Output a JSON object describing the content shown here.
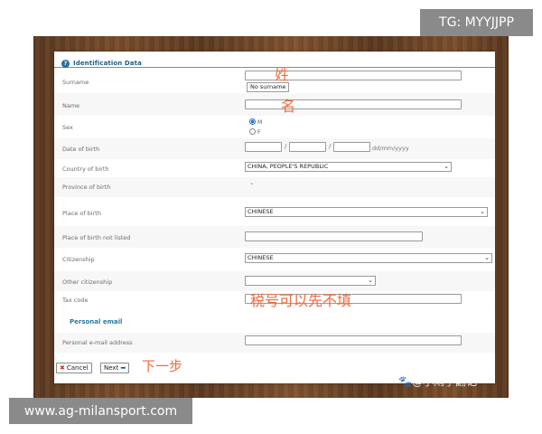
{
  "overlays": {
    "tg_badge": "TG: MYYJJPP",
    "url_badge": "www.ag-milansport.com",
    "watermark": "🐾@小雨学翻记"
  },
  "form": {
    "section_title": "Identification Data",
    "fields": {
      "surname_label": "Surname",
      "no_surname_button": "No surname",
      "name_label": "Name",
      "sex_label": "Sex",
      "sex_options": [
        "M",
        "F"
      ],
      "sex_selected": "M",
      "dob_label": "Date of birth",
      "dob_format_hint": "dd/mm/yyyy",
      "country_of_birth_label": "Country of birth",
      "country_of_birth_value": "CHINA, PEOPLE'S REPUBLIC",
      "province_of_birth_label": "Province of birth",
      "place_of_birth_label": "Place of birth",
      "place_of_birth_value": "CHINESE",
      "place_not_listed_label": "Place of birth not listed",
      "citizenship_label": "Citizenship",
      "citizenship_value": "CHINESE",
      "other_citizenship_label": "Other citizenship",
      "tax_code_label": "Tax code"
    },
    "personal_email_heading": "Personal email",
    "personal_email_label": "Personal e-mail address",
    "buttons": {
      "cancel": "Cancel",
      "next": "Next"
    }
  },
  "annotations": {
    "surname_note": "姓",
    "name_note": "名",
    "tax_code_note": "税号可以先不填",
    "next_step_note": "下一步"
  }
}
